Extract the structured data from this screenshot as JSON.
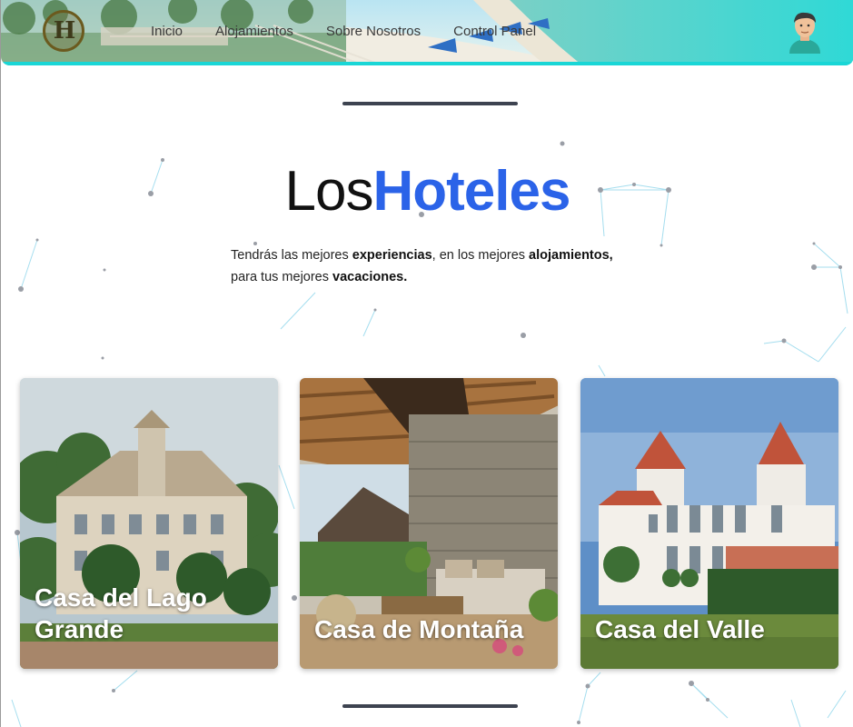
{
  "header": {
    "logo_letter": "H",
    "nav": [
      "Inicio",
      "Alojamientos",
      "Sobre Nosotros",
      "Control Panel"
    ]
  },
  "hero": {
    "title_light": "Los",
    "title_bold": "Hoteles",
    "lead": {
      "p1": "Tendrás las mejores ",
      "b1": "experiencias",
      "p2": ", en los mejores ",
      "b2": "alojamientos,",
      "p3": "para tus mejores ",
      "b3": "vacaciones."
    }
  },
  "cards": [
    {
      "title": "Casa del Lago Grande"
    },
    {
      "title": "Casa de Montaña"
    },
    {
      "title": "Casa del Valle"
    }
  ],
  "colors": {
    "accent": "#2b63e8",
    "divider": "#3d4350"
  }
}
